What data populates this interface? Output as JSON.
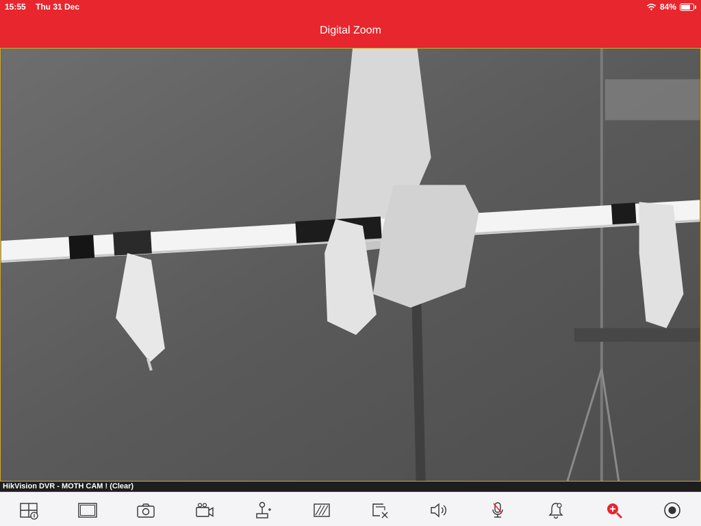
{
  "status_bar": {
    "time": "15:55",
    "date": "Thu 31 Dec",
    "battery": "84%",
    "battery_level": 0.84
  },
  "header": {
    "title": "Digital Zoom",
    "background_color": "#e7262e"
  },
  "video": {
    "channel_label": "HikVision DVR - MOTH CAM ! (Clear)"
  },
  "toolbar": {
    "accent_color": "#e7262e",
    "items": [
      {
        "icon": "window-split-icon"
      },
      {
        "icon": "single-window-icon"
      },
      {
        "icon": "camera-snapshot-icon"
      },
      {
        "icon": "video-record-icon"
      },
      {
        "icon": "ptz-joystick-icon"
      },
      {
        "icon": "image-quality-icon"
      },
      {
        "icon": "close-window-icon"
      },
      {
        "icon": "speaker-icon"
      },
      {
        "icon": "microphone-icon"
      },
      {
        "icon": "alarm-bell-icon"
      },
      {
        "icon": "digital-zoom-icon",
        "active": true
      },
      {
        "icon": "record-target-icon"
      }
    ]
  }
}
